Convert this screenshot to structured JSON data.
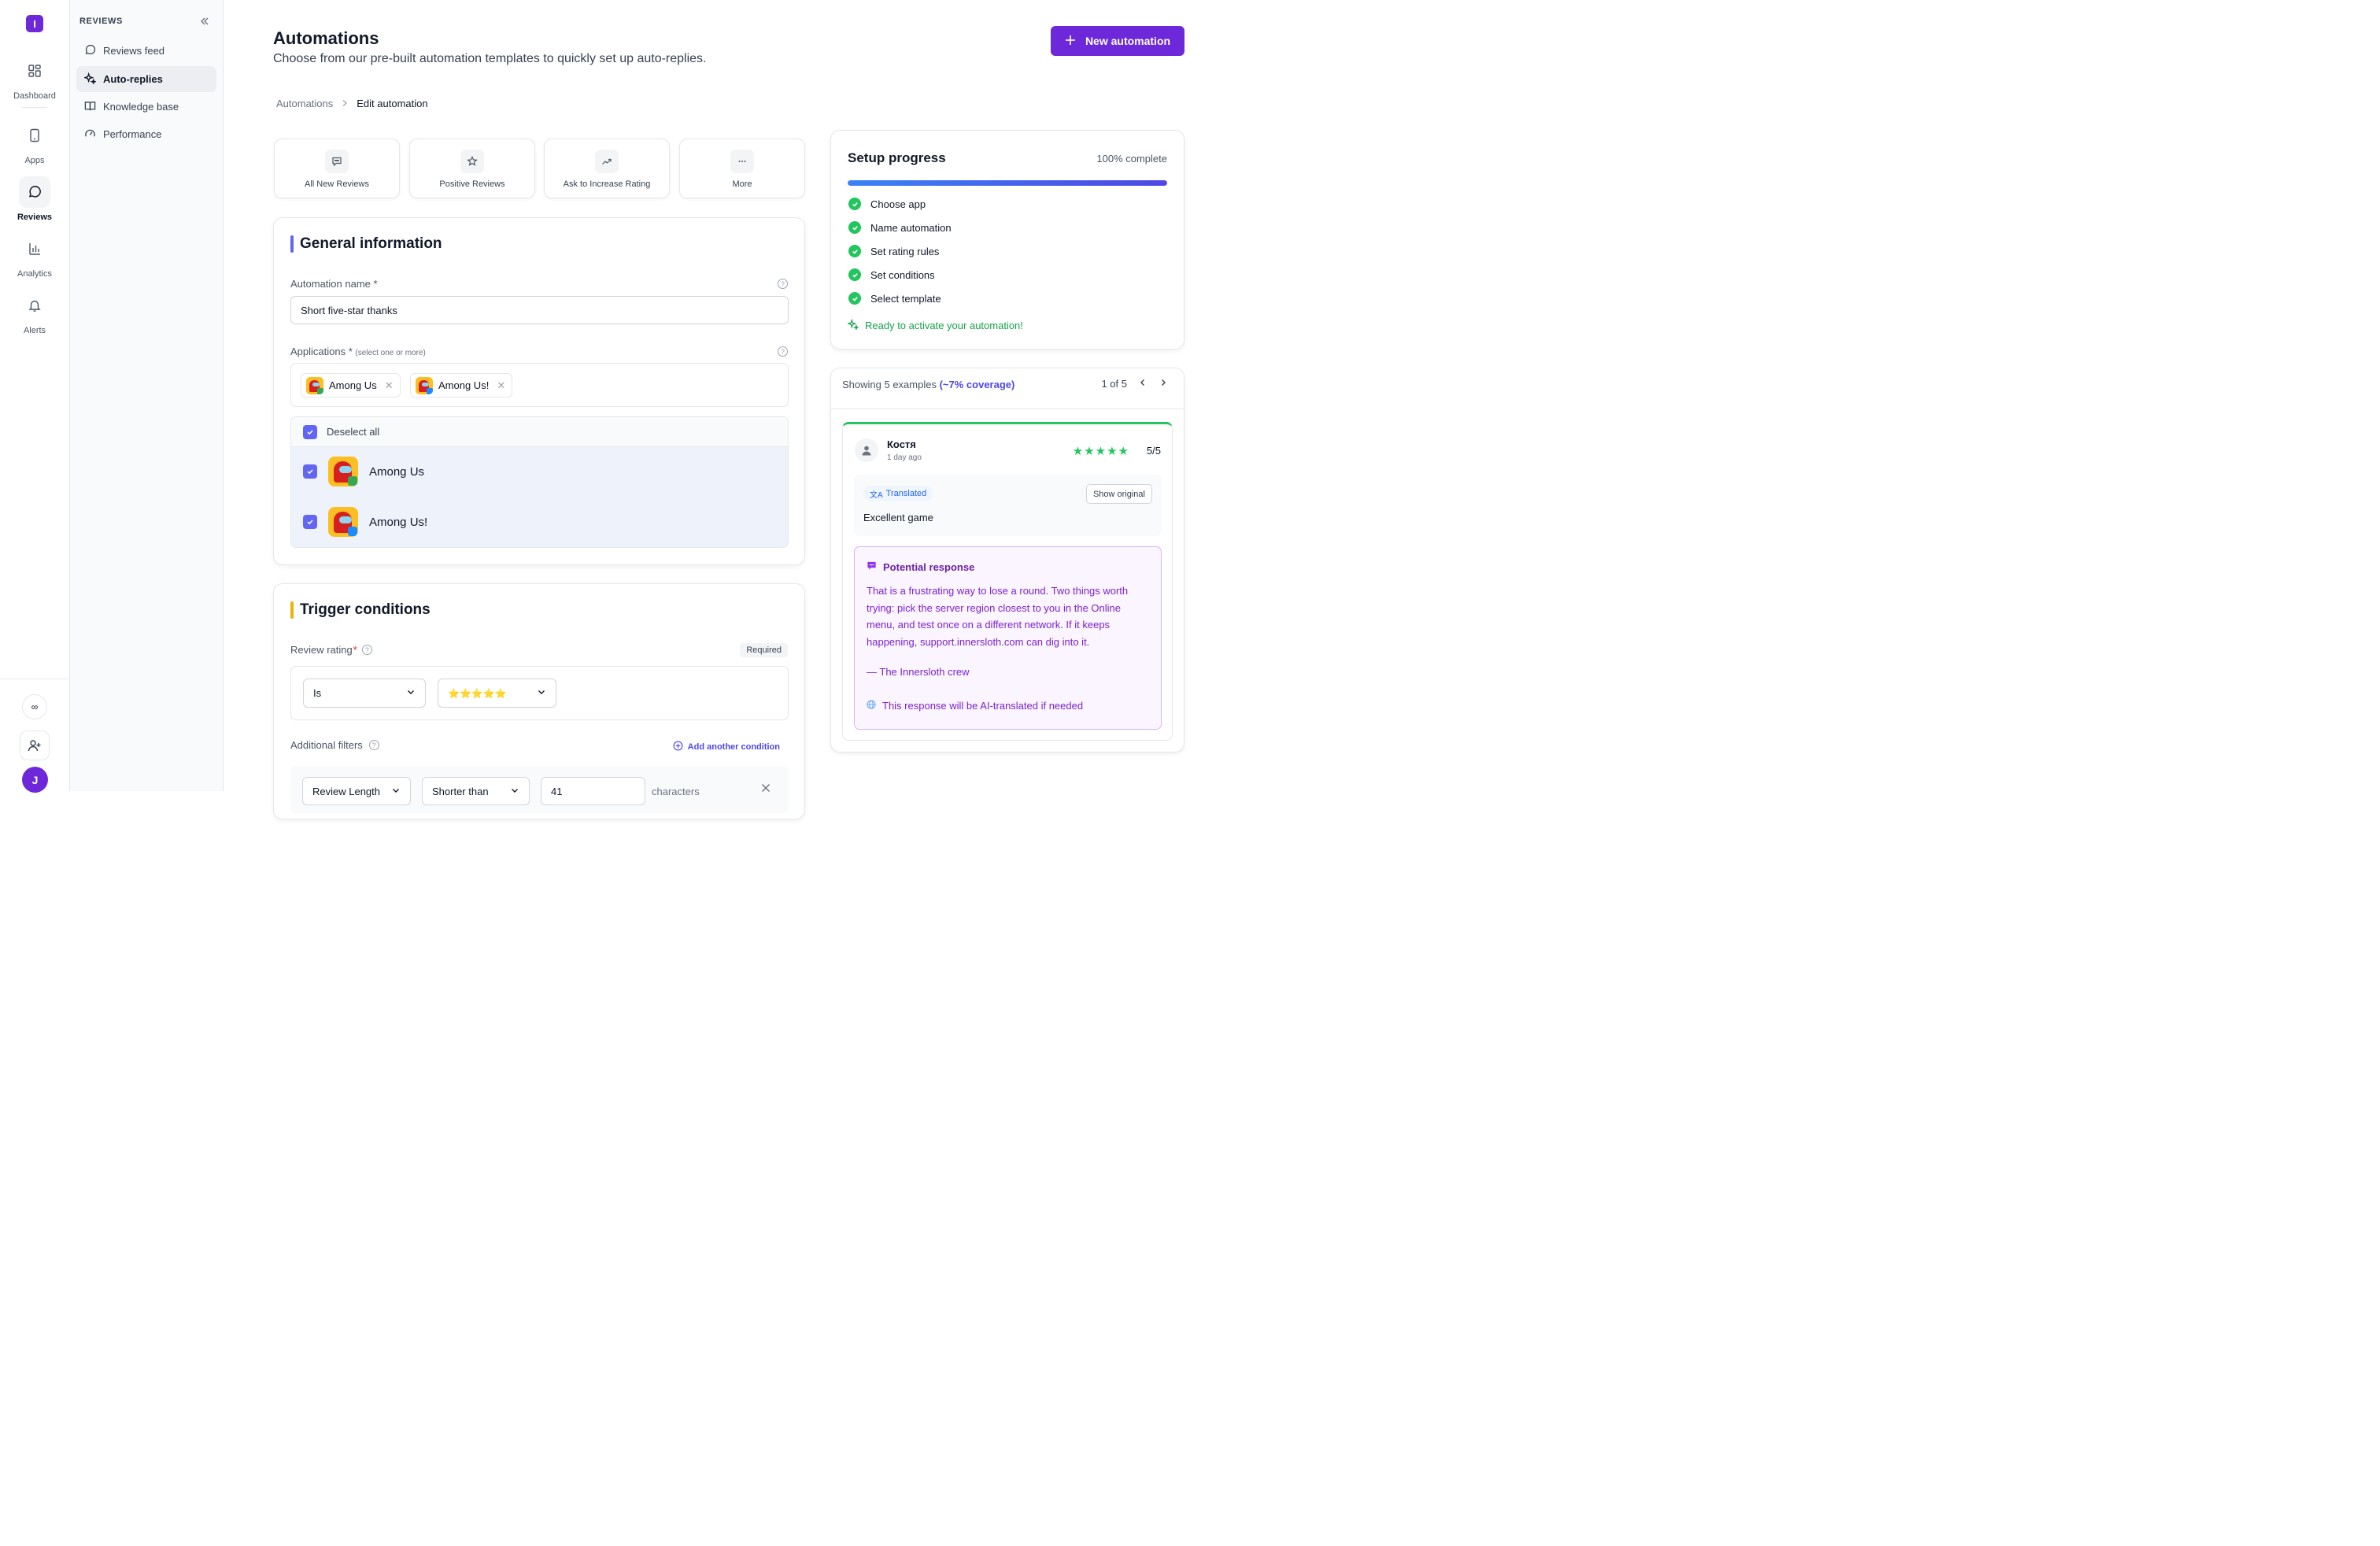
{
  "rail": {
    "logo_letter": "I",
    "items": [
      {
        "label": "Dashboard",
        "icon": "grid-icon"
      },
      {
        "label": "Apps",
        "icon": "phone-icon"
      },
      {
        "label": "Reviews",
        "icon": "chat-bubble-icon"
      },
      {
        "label": "Analytics",
        "icon": "bar-chart-icon"
      },
      {
        "label": "Alerts",
        "icon": "bell-icon"
      }
    ],
    "bottom_circle": "∞",
    "user_initial": "J"
  },
  "subnav": {
    "title": "REVIEWS",
    "items": [
      {
        "label": "Reviews feed",
        "icon": "chat-bubble-icon"
      },
      {
        "label": "Auto-replies",
        "icon": "sparkles-icon"
      },
      {
        "label": "Knowledge base",
        "icon": "book-icon"
      },
      {
        "label": "Performance",
        "icon": "gauge-icon"
      }
    ]
  },
  "header": {
    "title": "Automations",
    "subtitle": "Choose from our pre-built automation templates to quickly set up auto-replies.",
    "new_button": "New automation"
  },
  "breadcrumb": {
    "parent": "Automations",
    "current": "Edit automation"
  },
  "templates": [
    {
      "label": "All New Reviews",
      "icon": "message-icon"
    },
    {
      "label": "Positive Reviews",
      "icon": "star-icon"
    },
    {
      "label": "Ask to Increase Rating",
      "icon": "trending-up-icon"
    },
    {
      "label": "More",
      "icon": "ellipsis-icon"
    }
  ],
  "general": {
    "title": "General information",
    "name_label": "Automation name *",
    "name_value": "Short five-star thanks",
    "apps_label": "Applications *",
    "apps_hint": "(select one or more)",
    "chips": [
      "Among Us",
      "Among Us!"
    ],
    "deselect_all": "Deselect all",
    "apps": [
      "Among Us",
      "Among Us!"
    ]
  },
  "trigger": {
    "title": "Trigger conditions",
    "rating_label": "Review rating",
    "required_badge": "Required",
    "operator": "Is",
    "stars": "⭐⭐⭐⭐⭐",
    "filters_label": "Additional filters",
    "add_condition": "Add another condition",
    "filter": {
      "field": "Review Length",
      "operator": "Shorter than",
      "value": "41",
      "unit": "characters"
    }
  },
  "setup": {
    "title": "Setup progress",
    "percent_text": "100% complete",
    "progress": 1.0,
    "steps": [
      "Choose app",
      "Name automation",
      "Set rating rules",
      "Set conditions",
      "Select template"
    ],
    "ready": "Ready to activate your automation!"
  },
  "examples": {
    "showing": "Showing 5 examples",
    "coverage": "(~7% coverage)",
    "pager": "1 of 5",
    "review": {
      "author": "Костя",
      "time": "1 day ago",
      "stars": "★★★★★",
      "score": "5/5",
      "translated": "Translated",
      "show_original": "Show original",
      "text": "Excellent game"
    },
    "response": {
      "title": "Potential response",
      "text": "That is a frustrating way to lose a round. Two things worth trying: pick the server region closest to you in the Online menu, and test once on a different network. If it keeps happening, support.innersloth.com can dig into it.",
      "signature": "— The Innersloth crew",
      "ai_note": "This response will be AI-translated if needed"
    }
  },
  "colors": {
    "accent": "#6d28d9",
    "indigo": "#4f46e5",
    "success": "#22c55e"
  }
}
